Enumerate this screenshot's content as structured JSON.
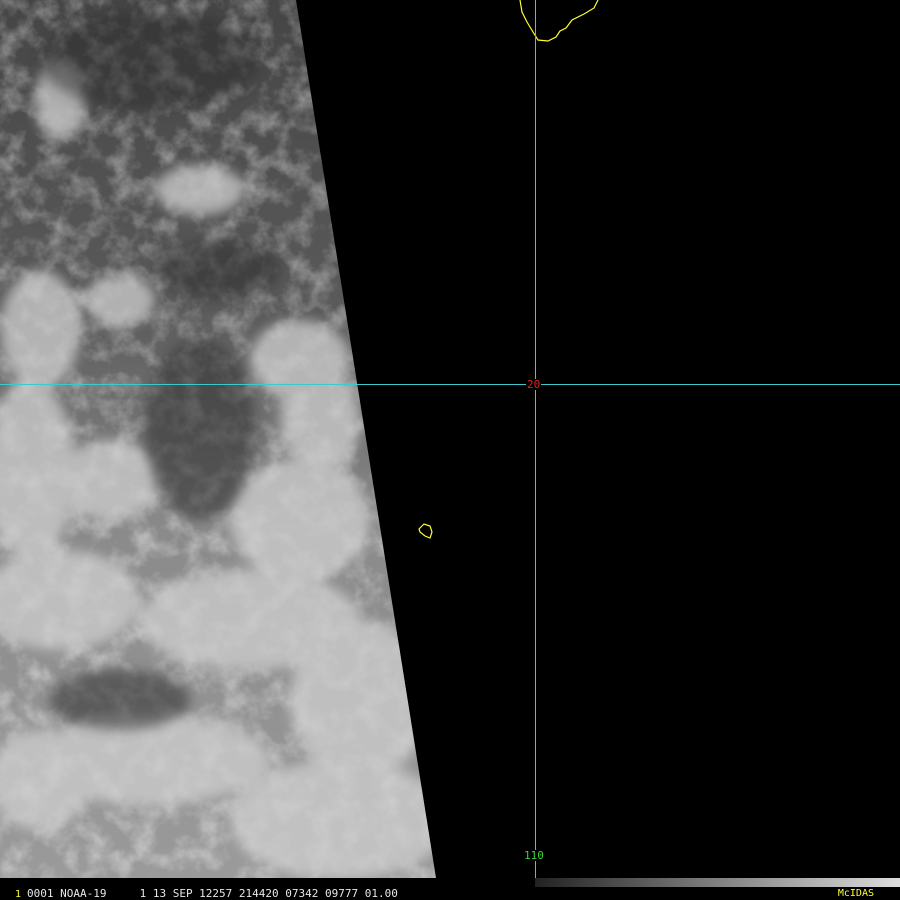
{
  "image": {
    "satellite": "NOAA-19",
    "status_text": "0001 NOAA-19     1 13 SEP 12257 214420 07342 09777 01.00",
    "frame_number": "1",
    "software_label": "McIDAS",
    "latitude_label": "20",
    "longitude_label": "110"
  },
  "colors": {
    "grid_line": "#3fc7d0",
    "coastline": "#ffff33",
    "latitude_label": "#e02020",
    "longitude_label": "#3cd23c",
    "frame_number": "#ffff33",
    "software_label": "#ffff33",
    "background": "#000000"
  }
}
